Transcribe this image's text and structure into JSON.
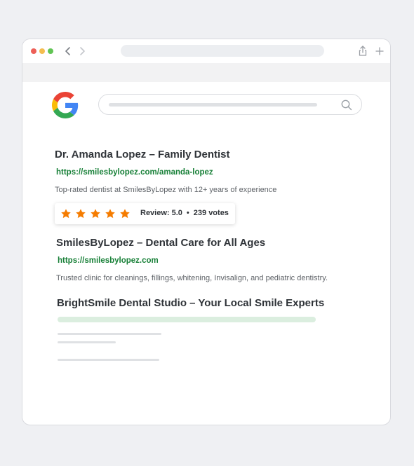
{
  "browser": {
    "window_controls": [
      "close",
      "minimize",
      "maximize"
    ],
    "icons": [
      "back-arrow-icon",
      "forward-arrow-icon",
      "share-icon",
      "plus-icon"
    ]
  },
  "search": {
    "logo": "google-logo",
    "icon": "search-icon"
  },
  "results": [
    {
      "title": "Dr. Amanda Lopez – Family Dentist",
      "url": "https://smilesbylopez.com/amanda-lopez",
      "description": "Top-rated dentist at SmilesByLopez with 12+ years of experience",
      "review": {
        "stars": 5,
        "max_stars": 5,
        "label": "Review: 5.0",
        "bullet": "•",
        "votes": "239 votes"
      }
    },
    {
      "title": "SmilesByLopez – Dental Care for All Ages",
      "url": "https://smilesbylopez.com",
      "description": "Trusted clinic for cleanings, fillings, whitening, Invisalign, and pediatric dentistry."
    },
    {
      "title": "BrightSmile Dental Studio – Your Local Smile Experts"
    }
  ],
  "colors": {
    "page_background": "#eff0f3",
    "url_green": "#188038",
    "star_orange": "#f57c00",
    "title_text": "#2f3338",
    "placeholder_green": "#dbeedf",
    "placeholder_gray": "#dfe1e4"
  }
}
